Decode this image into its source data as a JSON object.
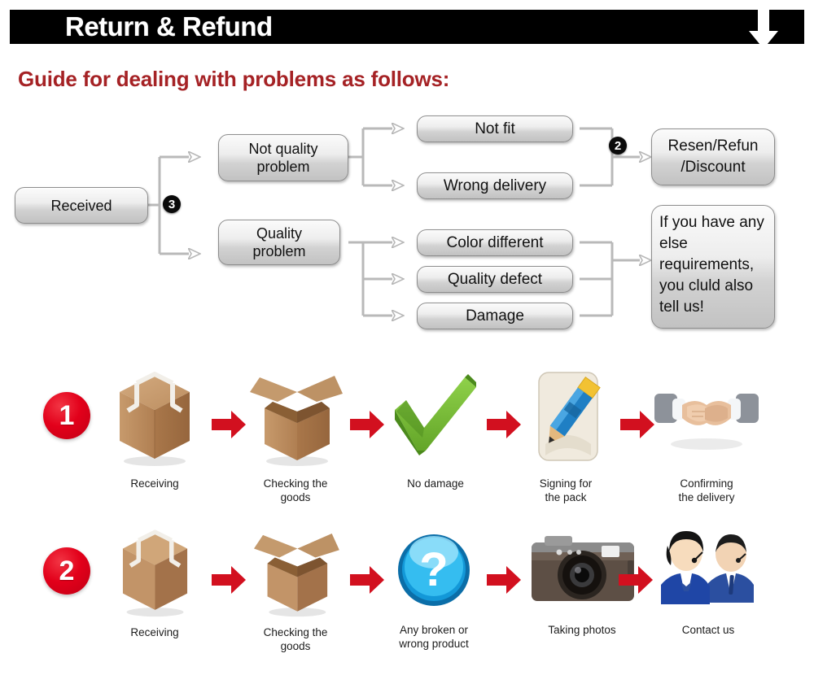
{
  "header": {
    "title": "Return & Refund",
    "arrow_icon": "arrow-down-icon",
    "bar_color": "#000000",
    "title_color": "#ffffff"
  },
  "guide": {
    "title": "Guide for dealing with problems as follows:",
    "color": "#A52225"
  },
  "flowchart": {
    "badges": [
      {
        "label": "3",
        "name": "badge-three"
      },
      {
        "label": "2",
        "name": "badge-two"
      }
    ],
    "nodes": {
      "received": "Received",
      "not_quality_problem": "Not quality\nproblem",
      "quality_problem": "Quality\nproblem",
      "not_fit": "Not fit",
      "wrong_delivery": "Wrong delivery",
      "color_different": "Color different",
      "quality_defect": "Quality defect",
      "damage": "Damage",
      "resend_refund_discount": "Resen/Refun\n/Discount",
      "note": "If you have any else requirements, you cluld also tell us!"
    }
  },
  "process": {
    "rows": [
      {
        "number": "1",
        "steps": [
          {
            "icon": "sealed-box-icon",
            "caption": "Receiving"
          },
          {
            "icon": "open-box-icon",
            "caption": "Checking the\ngoods"
          },
          {
            "icon": "green-check-icon",
            "caption": "No damage"
          },
          {
            "icon": "pencil-sign-icon",
            "caption": "Signing for\nthe pack"
          },
          {
            "icon": "handshake-icon",
            "caption": "Confirming\nthe delivery"
          }
        ]
      },
      {
        "number": "2",
        "steps": [
          {
            "icon": "sealed-box-icon",
            "caption": "Receiving"
          },
          {
            "icon": "open-box-icon",
            "caption": "Checking the\ngoods"
          },
          {
            "icon": "blue-question-icon",
            "caption": "Any broken or\nwrong product"
          },
          {
            "icon": "camera-icon",
            "caption": "Taking photos"
          },
          {
            "icon": "support-agents-icon",
            "caption": "Contact us"
          }
        ]
      }
    ],
    "arrow_icon": "red-arrow-right-icon",
    "arrow_color": "#D2101F",
    "number_color": "#E2001A"
  }
}
